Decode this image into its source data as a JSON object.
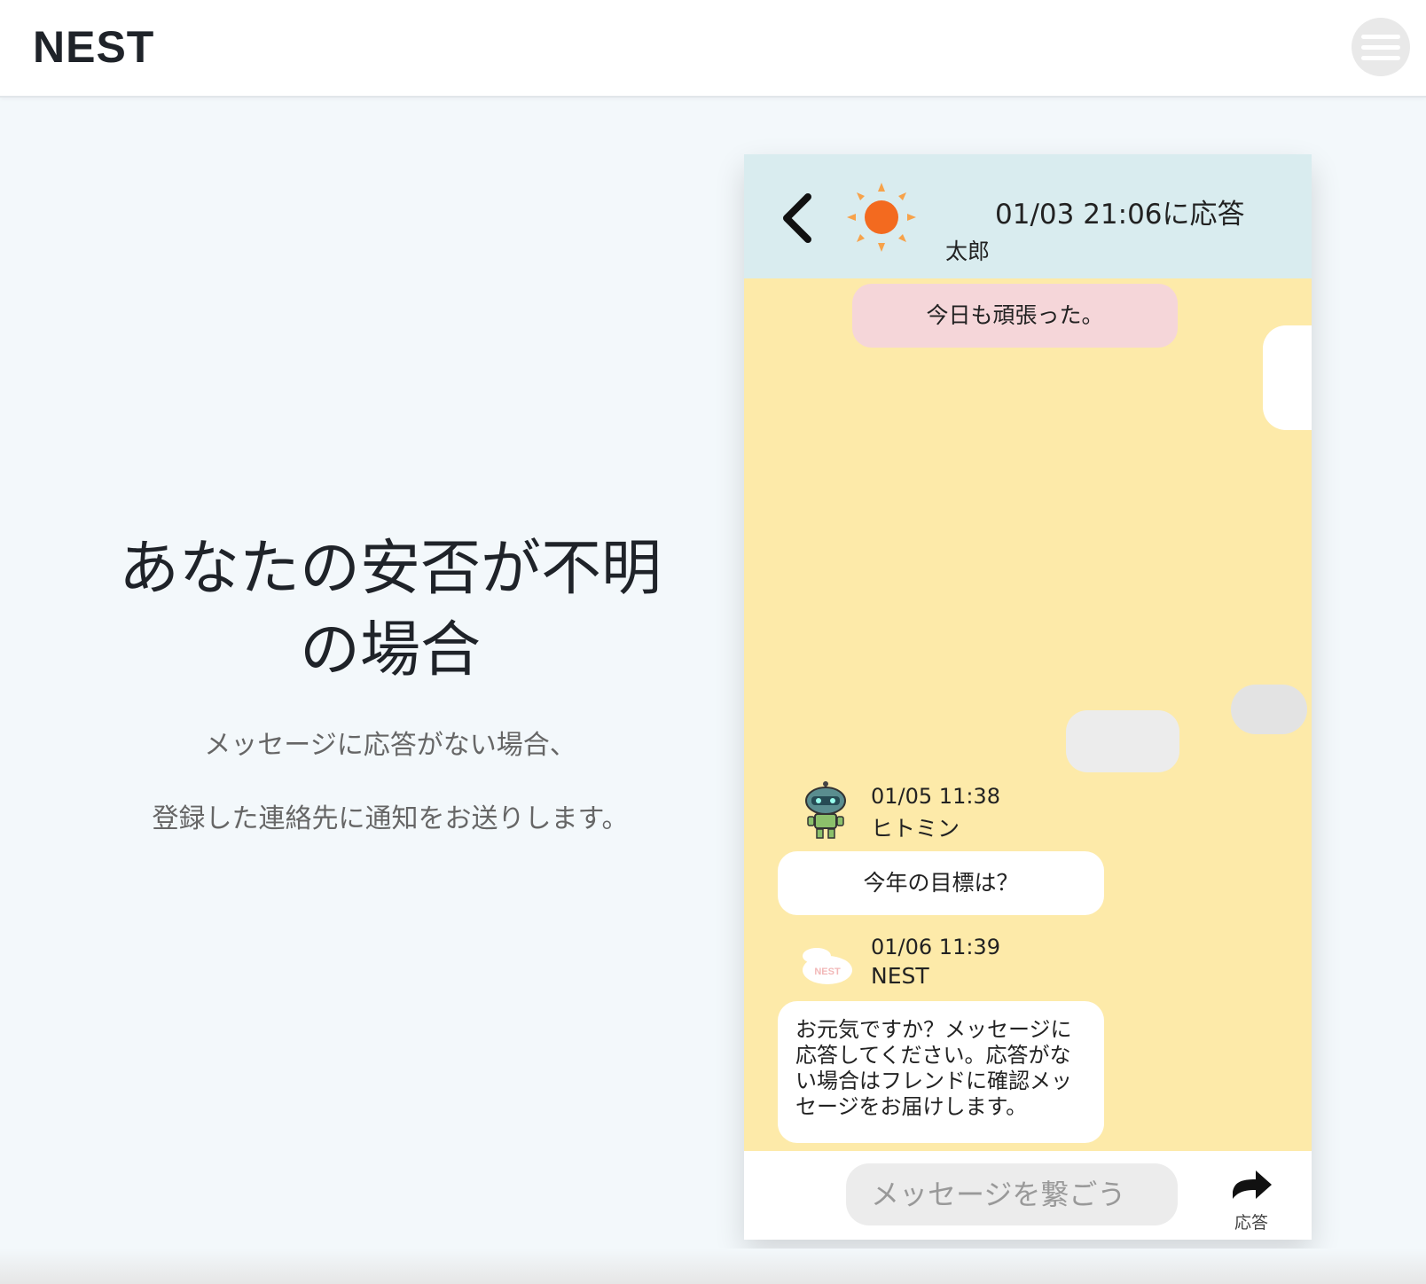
{
  "header": {
    "logo": "NEST",
    "menu_icon": "hamburger-menu-icon"
  },
  "hero": {
    "headline_line1": "あなたの安否が不明",
    "headline_line2": "の場合",
    "sub_line1": "メッセージに応答がない場合、",
    "sub_line2": "登録した連絡先に通知をお送りします。"
  },
  "chat": {
    "header": {
      "back_icon": "chevron-left-icon",
      "avatar_icon": "sun-icon",
      "time": "01/03  21:06に応答",
      "name": "太郎"
    },
    "messages": [
      {
        "text": "今日も頑張った。",
        "color": "#f5d6d9"
      },
      {
        "time": "01/05  11:38",
        "name": "ヒトミン",
        "avatar_icon": "robot-icon",
        "text": "今年の目標は？"
      },
      {
        "time": "01/06  11:39",
        "name": "NEST",
        "avatar_icon": "nest-logo-icon",
        "avatar_text": "NEST",
        "text": "お元気ですか？メッセージに応答してください。応答がない場合はフレンドに確認メッセージをお届けします。"
      }
    ],
    "input": {
      "placeholder": "メッセージを繋ごう",
      "send_icon": "arrow-right-icon",
      "send_label": "応答"
    },
    "colors": {
      "background": "#fdeaa9",
      "header": "#d9ecef",
      "sun": "#f36a1f"
    }
  }
}
